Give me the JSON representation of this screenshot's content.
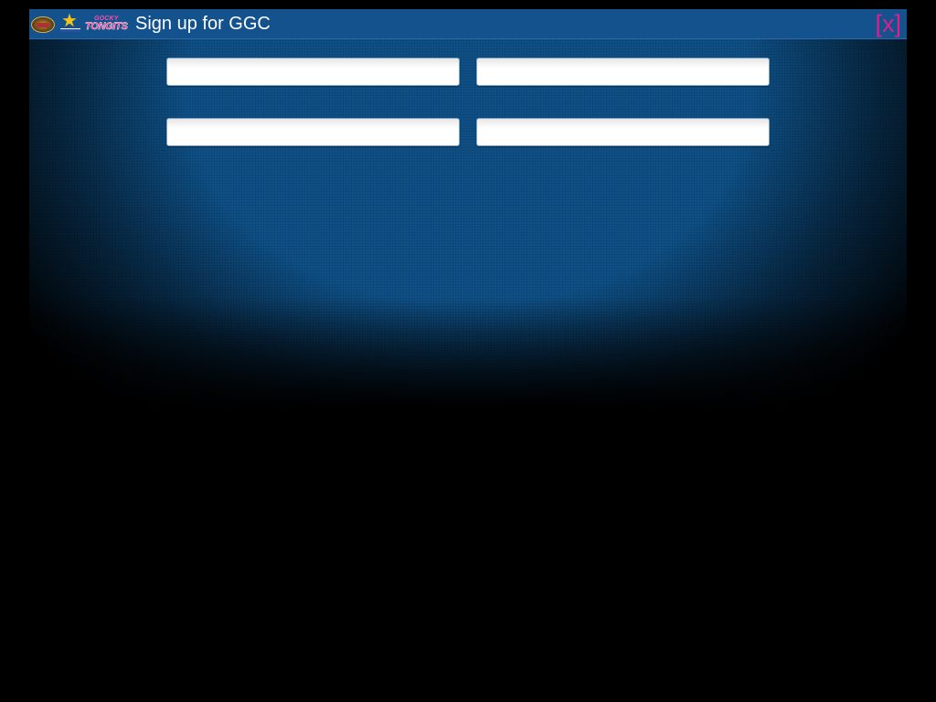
{
  "window": {
    "title": "Sign up for GGC",
    "close_label": "[x]"
  },
  "logos": [
    {
      "icon": "bulldog-logo-icon"
    },
    {
      "icon": "star-logo-icon"
    },
    {
      "icon": "tongits-logo-icon",
      "text_top": "GOCKY",
      "text_main": "TONGITS"
    }
  ],
  "form": {
    "fields": [
      {
        "value": "",
        "placeholder": ""
      },
      {
        "value": "",
        "placeholder": ""
      },
      {
        "value": "",
        "placeholder": ""
      },
      {
        "value": "",
        "placeholder": ""
      }
    ]
  },
  "colors": {
    "titlebar": "#14528e",
    "body": "#0e4f85",
    "close": "#d9208d",
    "background": "#000000"
  }
}
